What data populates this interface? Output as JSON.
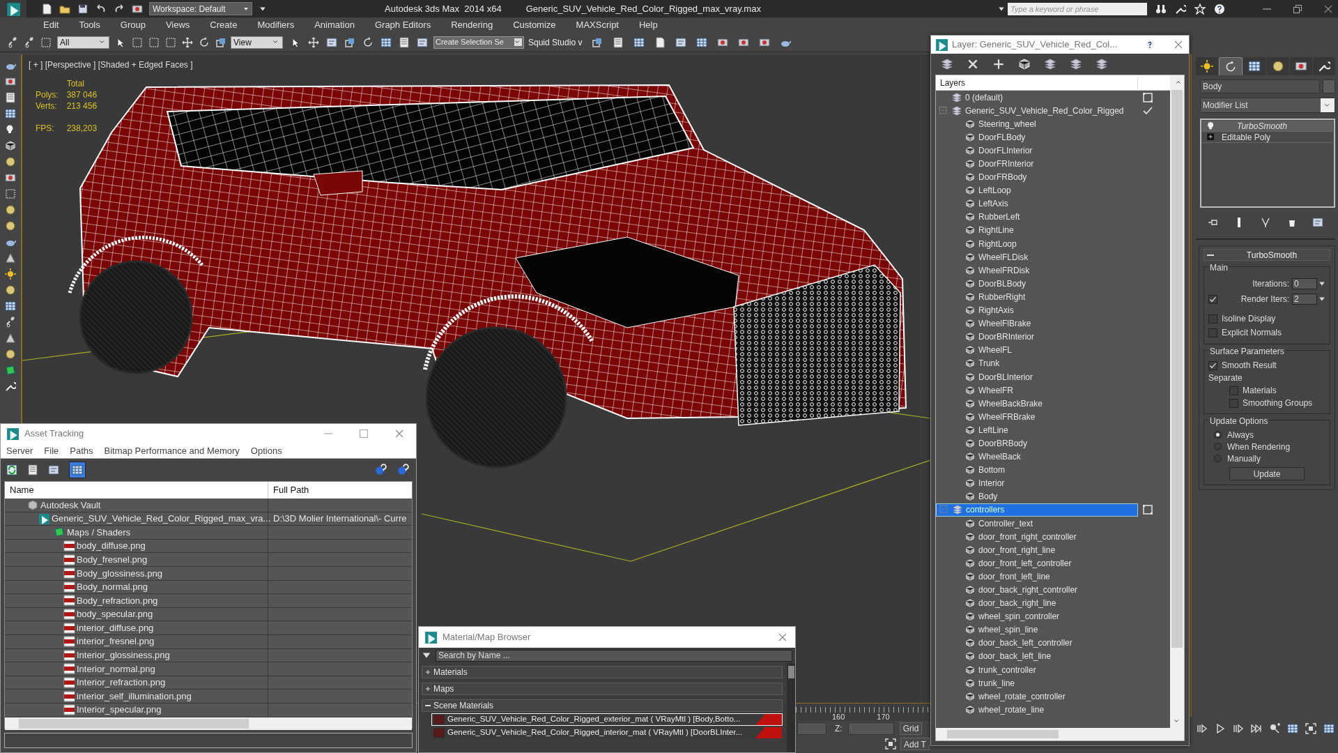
{
  "app": {
    "title": "Autodesk 3ds Max  2014 x64",
    "file": "Generic_SUV_Vehicle_Red_Color_Rigged_max_vray.max",
    "workspace": "Workspace: Default",
    "search_placeholder": "Type a keyword or phrase"
  },
  "menu": [
    "Edit",
    "Tools",
    "Group",
    "Views",
    "Create",
    "Modifiers",
    "Animation",
    "Graph Editors",
    "Rendering",
    "Customize",
    "MAXScript",
    "Help"
  ],
  "toolbar": {
    "filter": "All",
    "coordinate": "View",
    "selection_set": "Create Selection Se",
    "plugin": "Squid Studio v"
  },
  "viewport": {
    "label": "[ + ] [Perspective ] [Shaded + Edged Faces ]",
    "stats_header": "Total",
    "stats": [
      {
        "label": "Polys:",
        "value": "387 046"
      },
      {
        "label": "Verts:",
        "value": "213 456"
      },
      {
        "label": "FPS:",
        "value": "238,203"
      }
    ]
  },
  "asset_tracking": {
    "title": "Asset Tracking",
    "menu": [
      "Server",
      "File",
      "Paths",
      "Bitmap Performance and Memory",
      "Options"
    ],
    "columns": [
      "Name",
      "Full Path"
    ],
    "rows": [
      {
        "name": "Autodesk Vault",
        "kind": "vault",
        "children": [
          {
            "name": "Generic_SUV_Vehicle_Red_Color_Rigged_max_vra...",
            "path": "D:\\3D Molier International\\- Curre",
            "kind": "scene",
            "children": [
              {
                "name": "Maps / Shaders",
                "kind": "folder",
                "children": [
                  {
                    "name": "body_diffuse.png",
                    "kind": "png"
                  },
                  {
                    "name": "Body_fresnel.png",
                    "kind": "png"
                  },
                  {
                    "name": "Body_glossiness.png",
                    "kind": "png"
                  },
                  {
                    "name": "Body_normal.png",
                    "kind": "png"
                  },
                  {
                    "name": "Body_refraction.png",
                    "kind": "png"
                  },
                  {
                    "name": "body_specular.png",
                    "kind": "png"
                  },
                  {
                    "name": "interior_diffuse.png",
                    "kind": "png"
                  },
                  {
                    "name": "interior_fresnel.png",
                    "kind": "png"
                  },
                  {
                    "name": "Interior_glossiness.png",
                    "kind": "png"
                  },
                  {
                    "name": "Interior_normal.png",
                    "kind": "png"
                  },
                  {
                    "name": "Interior_refraction.png",
                    "kind": "png"
                  },
                  {
                    "name": "interior_self_illumination.png",
                    "kind": "png"
                  },
                  {
                    "name": "Interior_specular.png",
                    "kind": "png"
                  }
                ]
              }
            ]
          }
        ]
      }
    ]
  },
  "layers": {
    "title": "Layer: Generic_SUV_Vehicle_Red_Col...",
    "heading": "Layers",
    "items": [
      {
        "name": "0 (default)",
        "current": false,
        "selected": false
      },
      {
        "name": "Generic_SUV_Vehicle_Red_Color_Rigged",
        "current": true,
        "selected": false,
        "children": [
          {
            "name": "Steering_wheel"
          },
          {
            "name": "DoorFLBody"
          },
          {
            "name": "DoorFLInterior"
          },
          {
            "name": "DoorFRInterior"
          },
          {
            "name": "DoorFRBody"
          },
          {
            "name": "LeftLoop"
          },
          {
            "name": "LeftAxis"
          },
          {
            "name": "RubberLeft"
          },
          {
            "name": "RightLine"
          },
          {
            "name": "RightLoop"
          },
          {
            "name": "WheelFLDisk"
          },
          {
            "name": "WheelFRDisk"
          },
          {
            "name": "DoorBLBody"
          },
          {
            "name": "RubberRight"
          },
          {
            "name": "RightAxis"
          },
          {
            "name": "WheelFlBrake"
          },
          {
            "name": "DoorBRInterior"
          },
          {
            "name": "WheelFL"
          },
          {
            "name": "Trunk"
          },
          {
            "name": "DoorBLInterior"
          },
          {
            "name": "WheelFR"
          },
          {
            "name": "WheelBackBrake"
          },
          {
            "name": "WheelFRBrake"
          },
          {
            "name": "LeftLine"
          },
          {
            "name": "DoorBRBody"
          },
          {
            "name": "WheelBack"
          },
          {
            "name": "Bottom"
          },
          {
            "name": "Interior"
          },
          {
            "name": "Body"
          }
        ]
      },
      {
        "name": "controllers",
        "current": false,
        "selected": true,
        "children": [
          {
            "name": "Controller_text"
          },
          {
            "name": "door_front_right_controller"
          },
          {
            "name": "door_front_right_line"
          },
          {
            "name": "door_front_left_controller"
          },
          {
            "name": "door_front_left_line"
          },
          {
            "name": "door_back_right_controller"
          },
          {
            "name": "door_back_right_line"
          },
          {
            "name": "wheel_spin_controller"
          },
          {
            "name": "wheel_spin_line"
          },
          {
            "name": "door_back_left_controller"
          },
          {
            "name": "door_back_left_line"
          },
          {
            "name": "trunk_controller"
          },
          {
            "name": "trunk_line"
          },
          {
            "name": "wheel_rotate_controller"
          },
          {
            "name": "wheel_rotate_line"
          }
        ]
      }
    ]
  },
  "command_panel": {
    "tabs": [
      {
        "kind": "create",
        "selected": false
      },
      {
        "kind": "modify",
        "selected": true
      },
      {
        "kind": "hierarchy",
        "selected": false
      },
      {
        "kind": "motion",
        "selected": false
      },
      {
        "kind": "display",
        "selected": false
      },
      {
        "kind": "utilities",
        "selected": false
      }
    ],
    "object_name": "Body",
    "modifier_list": "Modifier List",
    "stack": [
      {
        "name": "TurboSmooth",
        "selected": true
      },
      {
        "name": "Editable Poly",
        "selected": false
      }
    ],
    "rollout": {
      "title": "TurboSmooth",
      "main": "Main",
      "iterations": {
        "label": "Iterations:",
        "value": "0"
      },
      "render_iters": {
        "label": "Render Iters:",
        "value": "2",
        "checked": true
      },
      "options": [
        {
          "label": "Isoline Display",
          "checked": false
        },
        {
          "label": "Explicit Normals",
          "checked": false
        }
      ],
      "surface": "Surface Parameters",
      "smooth_result": {
        "label": "Smooth Result",
        "checked": true
      },
      "separate": "Separate",
      "separate_options": [
        {
          "label": "Materials",
          "checked": false
        },
        {
          "label": "Smoothing Groups",
          "checked": false
        }
      ],
      "update_title": "Update Options",
      "update_options": [
        {
          "label": "Always",
          "selected": true
        },
        {
          "label": "When Rendering",
          "selected": false
        },
        {
          "label": "Manually",
          "selected": false
        }
      ],
      "update_button": "Update"
    }
  },
  "material_browser": {
    "title": "Material/Map Browser",
    "search_placeholder": "Search by Name ...",
    "groups": [
      {
        "label": "Materials",
        "expanded": false
      },
      {
        "label": "Maps",
        "expanded": false
      },
      {
        "label": "Scene Materials",
        "expanded": true
      }
    ],
    "materials": [
      {
        "name": "Generic_SUV_Vehicle_Red_Color_Rigged_exterior_mat ( VRayMtl ) [Body,Botto...",
        "selected": true
      },
      {
        "name": "Generic_SUV_Vehicle_Red_Color_Rigged_interior_mat ( VRayMtl ) [DoorBLInter...",
        "selected": false
      }
    ]
  },
  "timeline": {
    "ticks": [
      "160",
      "170"
    ],
    "z_label": "Z:",
    "grid": "Grid",
    "add": "Add T"
  }
}
